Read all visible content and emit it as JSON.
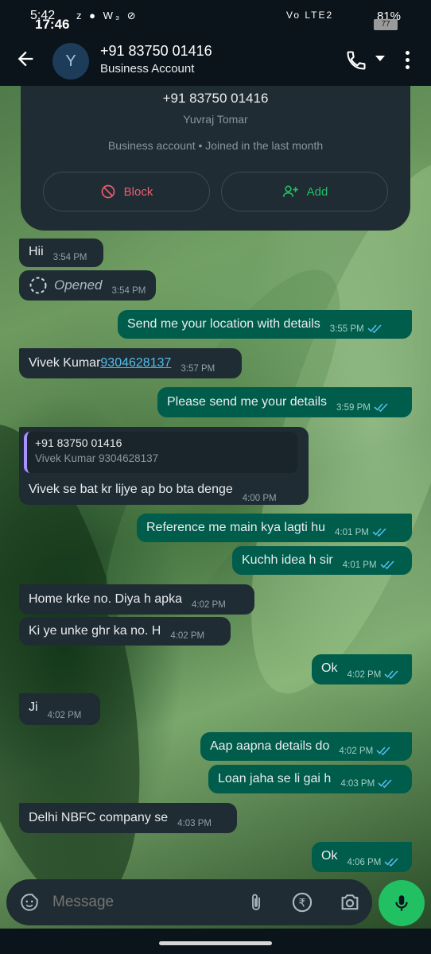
{
  "status_bar": {
    "time_back": "5:42",
    "time_front": "17:46",
    "left_icons": "z ● W₃ ⊘",
    "signal": "Vo LTE2",
    "battery": "81%",
    "badge": "77"
  },
  "header": {
    "avatar_letter": "Y",
    "title": "+91 83750 01416",
    "subtitle": "Business Account"
  },
  "business_card": {
    "phone": "+91 83750 01416",
    "name": "Yuvraj Tomar",
    "info": "Business account • Joined in the last month",
    "block_label": "Block",
    "add_label": "Add"
  },
  "messages": [
    {
      "dir": "in",
      "text": "Hii",
      "time": "3:54 PM"
    },
    {
      "dir": "in",
      "text": "Opened",
      "time": "3:54 PM"
    },
    {
      "dir": "out",
      "text": "Send me your location with details",
      "time": "3:55 PM"
    },
    {
      "dir": "in",
      "text": "Vivek Kumar",
      "link": "9304628137",
      "time": "3:57 PM"
    },
    {
      "dir": "out",
      "text": "Please send me your details",
      "time": "3:59 PM"
    },
    {
      "dir": "in",
      "quote_title": "+91 83750 01416",
      "quote_text": "Vivek Kumar 9304628137",
      "text": "Vivek se bat kr lijye ap bo bta denge",
      "time": "4:00 PM"
    },
    {
      "dir": "out",
      "text": "Reference me main kya lagti hu",
      "time": "4:01 PM"
    },
    {
      "dir": "out",
      "text": "Kuchh idea h sir",
      "time": "4:01 PM"
    },
    {
      "dir": "in",
      "text": "Home krke no. Diya h apka",
      "time": "4:02 PM"
    },
    {
      "dir": "in",
      "text": "Ki ye unke ghr ka no. H",
      "time": "4:02 PM"
    },
    {
      "dir": "out",
      "text": "Ok",
      "time": "4:02 PM"
    },
    {
      "dir": "in",
      "text": "Ji",
      "time": "4:02 PM"
    },
    {
      "dir": "out",
      "text": "Aap aapna details do",
      "time": "4:02 PM"
    },
    {
      "dir": "out",
      "text": "Loan jaha se li gai h",
      "time": "4:03 PM"
    },
    {
      "dir": "in",
      "text": "Delhi NBFC company se",
      "time": "4:03 PM"
    },
    {
      "dir": "out",
      "text": "Ok",
      "time": "4:06 PM"
    }
  ],
  "composer": {
    "placeholder": "Message"
  },
  "colors": {
    "incoming": "#1f2c33",
    "outgoing": "#005c4b",
    "accent_green": "#21c063",
    "block_red": "#f15c6d",
    "link_blue": "#53bdeb"
  }
}
